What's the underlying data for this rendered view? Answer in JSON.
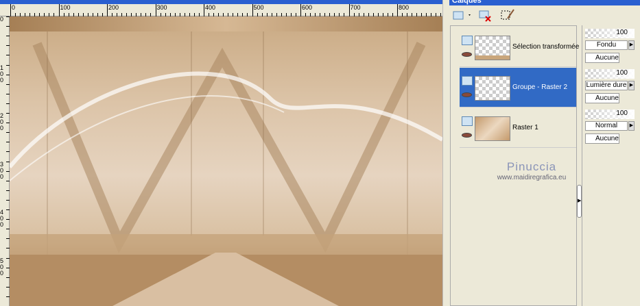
{
  "ruler": {
    "h_labels": [
      "0",
      "100",
      "200",
      "300",
      "400",
      "500",
      "600",
      "700",
      "800"
    ],
    "v_labels": [
      "0",
      "1 0 0",
      "2 0 0",
      "3 0 0",
      "4 0 0",
      "5 0 0"
    ]
  },
  "panel": {
    "title": "Calques",
    "layers": [
      {
        "name": "Sélection transformée",
        "opacity": "100",
        "blend": "Fondu",
        "mask": "Aucune",
        "selected": false
      },
      {
        "name": "Groupe - Raster 2",
        "opacity": "100",
        "blend": "Lumière dure",
        "mask": "Aucune",
        "selected": true
      },
      {
        "name": "Raster 1",
        "opacity": "100",
        "blend": "Normal",
        "mask": "Aucune",
        "selected": false
      }
    ]
  },
  "watermark": {
    "name": "Pinuccia",
    "url": "www.maidiregrafica.eu"
  },
  "colors": {
    "selection": "#316ac5",
    "titlebar": "#2a5fd0",
    "panel": "#ece9d8"
  }
}
